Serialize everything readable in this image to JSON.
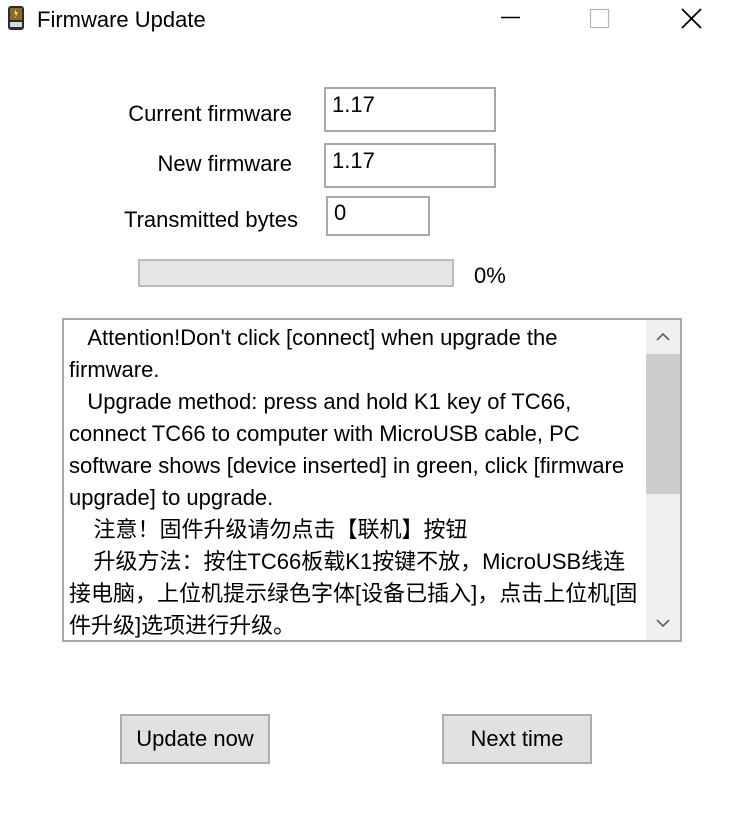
{
  "window": {
    "title": "Firmware Update",
    "icons": [
      "app-icon",
      "minimize-icon",
      "maximize-icon",
      "close-icon"
    ]
  },
  "form": {
    "current_label": "Current firmware",
    "current_value": "1.17",
    "new_label": "New firmware",
    "new_value": "1.17",
    "bytes_label": "Transmitted bytes",
    "bytes_value": "0"
  },
  "progress": {
    "value": 0,
    "label": "0%"
  },
  "notes": {
    "text": "   Attention!Don't click [connect] when upgrade the firmware.\n   Upgrade method: press and hold K1 key of TC66, connect TC66 to computer with MicroUSB cable, PC software shows [device inserted] in green, click [firmware upgrade] to upgrade.\n    注意！固件升级请勿点击【联机】按钮\n    升级方法：按住TC66板载K1按键不放，MicroUSB线连接电脑，上位机提示绿色字体[设备已插入]，点击上位机[固件升级]选项进行升级。"
  },
  "buttons": {
    "update_now": "Update now",
    "next_time": "Next time"
  },
  "colors": {
    "progress_fill": "#06b025",
    "button_bg": "#e1e1e1",
    "border": "#a8a8a8"
  }
}
